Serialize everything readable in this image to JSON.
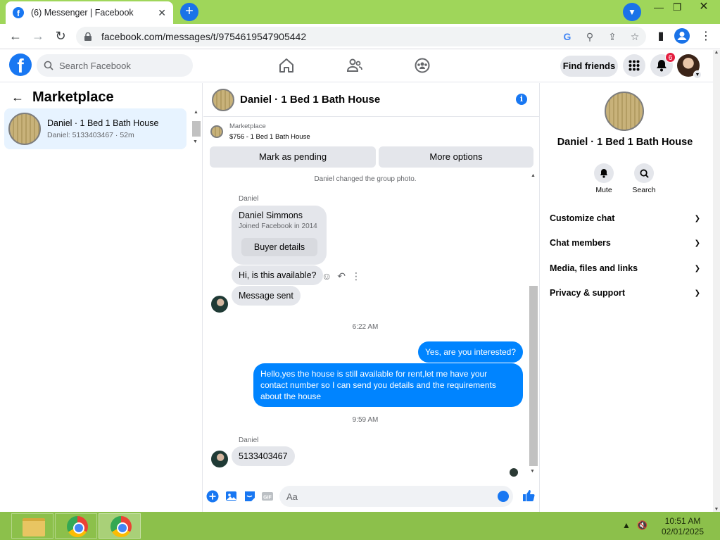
{
  "browser": {
    "tab_title": "(6) Messenger | Facebook",
    "url": "facebook.com/messages/t/9754619547905442"
  },
  "header": {
    "search_placeholder": "Search Facebook",
    "find_friends": "Find friends",
    "notification_count": "6"
  },
  "left_panel": {
    "title": "Marketplace",
    "conversation": {
      "name": "Daniel · 1 Bed 1 Bath House",
      "preview": "Daniel: 5133403467 · 52m"
    }
  },
  "chat": {
    "title": "Daniel · 1 Bed 1 Bath House",
    "marketplace_label": "Marketplace",
    "listing": "$756 - 1 Bed 1 Bath House",
    "mark_pending": "Mark as pending",
    "more_options": "More options",
    "system_message": "Daniel changed the group photo.",
    "sender_1": "Daniel",
    "profile_card": {
      "name": "Daniel Simmons",
      "joined": "Joined Facebook in 2014",
      "button": "Buyer details"
    },
    "msg_available": "Hi, is this available?",
    "msg_sent": "Message sent",
    "time_1": "6:22 AM",
    "out_1": "Yes, are you interested?",
    "out_2": "Hello,yes the house is still available for rent,let me have your contact number   so I can send you details and the requirements about the house",
    "time_2": "9:59 AM",
    "sender_2": "Daniel",
    "msg_number": "5133403467",
    "input_placeholder": "Aa"
  },
  "right_panel": {
    "name": "Daniel · 1 Bed 1 Bath House",
    "mute": "Mute",
    "search": "Search",
    "sections": [
      "Customize chat",
      "Chat members",
      "Media, files and links",
      "Privacy & support"
    ]
  },
  "taskbar": {
    "time": "10:51 AM",
    "date": "02/01/2025"
  },
  "colors": {
    "fb_blue": "#1877f2",
    "messenger_blue": "#0084ff",
    "chrome_green": "#9fd65a",
    "taskbar_green": "#8cc04b"
  }
}
